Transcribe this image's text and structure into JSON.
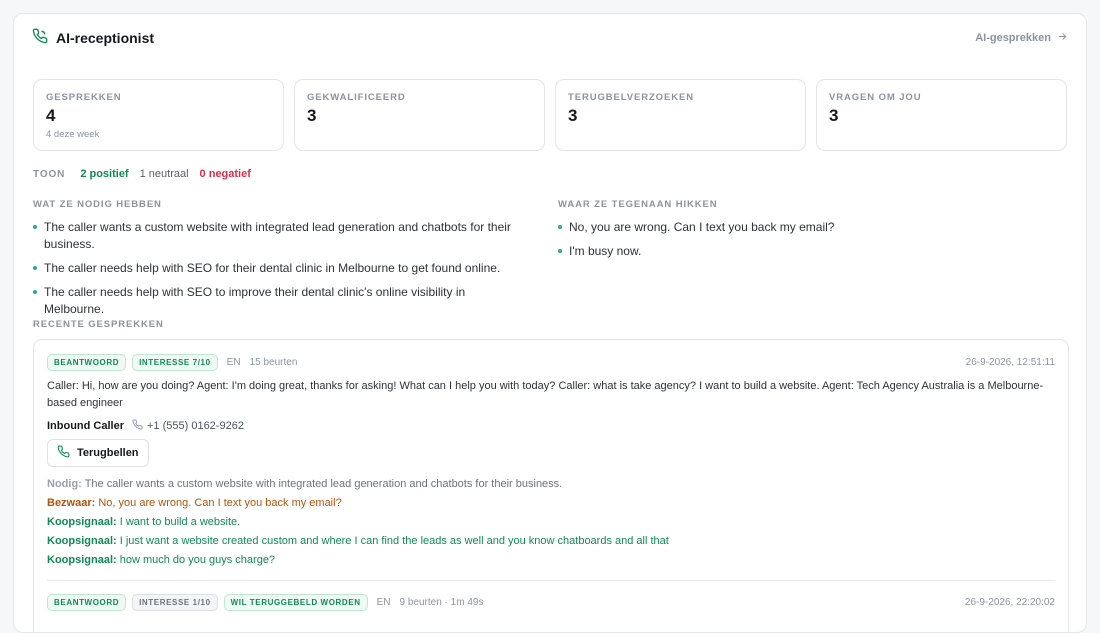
{
  "header": {
    "title": "AI-receptionist",
    "link_label": "AI-gesprekken"
  },
  "stats": [
    {
      "label": "GESPREKKEN",
      "value": "4",
      "sub": "4 deze week"
    },
    {
      "label": "GEKWALIFICEERD",
      "value": "3",
      "sub": ""
    },
    {
      "label": "TERUGBELVERZOEKEN",
      "value": "3",
      "sub": ""
    },
    {
      "label": "VRAGEN OM JOU",
      "value": "3",
      "sub": ""
    }
  ],
  "tone": {
    "label": "TOON",
    "positive": "2 positief",
    "neutral": "1 neutraal",
    "negative": "0 negatief"
  },
  "needs": {
    "label": "WAT ZE NODIG HEBBEN",
    "items": [
      "The caller wants a custom website with integrated lead generation and chatbots for their business.",
      "The caller needs help with SEO for their dental clinic in Melbourne to get found online.",
      "The caller needs help with SEO to improve their dental clinic's online visibility in Melbourne."
    ]
  },
  "objections": {
    "label": "WAAR ZE TEGENAAN HIKKEN",
    "items": [
      "No, you are wrong. Can I text you back my email?",
      "I'm busy now."
    ]
  },
  "recent": {
    "label": "RECENTE GESPREKKEN",
    "conversations": [
      {
        "badges": [
          "BEANTWOORD",
          "INTERESSE 7/10"
        ],
        "language": "EN",
        "turns": "15 beurten",
        "timestamp": "26-9-2026, 12:51:11",
        "transcript": "Caller: Hi, how are you doing? Agent: I'm doing great, thanks for asking! What can I help you with today? Caller: what is take agency? I want to build a website. Agent: Tech Agency Australia is a Melbourne-based engineer",
        "caller_name": "Inbound Caller",
        "caller_phone": "+1 (555) 0162-9262",
        "callback_label": "Terugbellen",
        "need": {
          "key": "Nodig:",
          "value": "The caller wants a custom website with integrated lead generation and chatbots for their business."
        },
        "objection": {
          "key": "Bezwaar:",
          "value": "No, you are wrong. Can I text you back my email?"
        },
        "buy_signals": [
          {
            "key": "Koopsignaal:",
            "value": "I want to build a website."
          },
          {
            "key": "Koopsignaal:",
            "value": "I just want a website created custom and where I can find the leads as well and you know chatboards and all that"
          },
          {
            "key": "Koopsignaal:",
            "value": "how much do you guys charge?"
          }
        ]
      },
      {
        "badges": [
          "BEANTWOORD",
          "INTERESSE 1/10",
          "WIL TERUGGEBELD WORDEN"
        ],
        "language": "EN",
        "turns": "9 beurten · 1m 49s",
        "timestamp": "26-9-2026, 22:20:02"
      }
    ]
  },
  "colors": {
    "accent_green": "#108a54",
    "negative_red": "#d6304b",
    "objection_amber": "#b45309",
    "bullet_teal": "#28a89a"
  },
  "icons": {
    "header": "phone-icon",
    "link": "arrow-right-icon",
    "phone": "phone-icon"
  }
}
